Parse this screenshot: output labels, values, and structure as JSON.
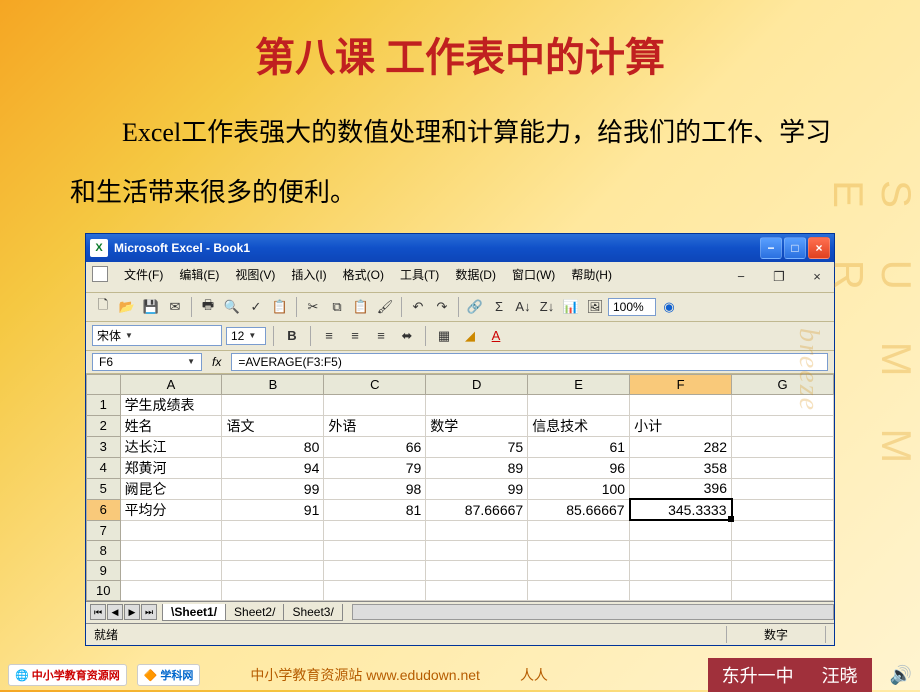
{
  "slide": {
    "title": "第八课  工作表中的计算",
    "intro": "Excel工作表强大的数值处理和计算能力，给我们的工作、学习和生活带来很多的便利。"
  },
  "excel": {
    "window_title": "Microsoft Excel - Book1",
    "menu": [
      "文件(F)",
      "编辑(E)",
      "视图(V)",
      "插入(I)",
      "格式(O)",
      "工具(T)",
      "数据(D)",
      "窗口(W)",
      "帮助(H)"
    ],
    "zoom": "100%",
    "font_name": "宋体",
    "font_size": "12",
    "name_box": "F6",
    "formula": "=AVERAGE(F3:F5)",
    "columns": [
      "A",
      "B",
      "C",
      "D",
      "E",
      "F",
      "G"
    ],
    "rows": [
      "1",
      "2",
      "3",
      "4",
      "5",
      "6",
      "7",
      "8",
      "9",
      "10"
    ],
    "table_title": "学生成绩表",
    "headers": [
      "姓名",
      "语文",
      "外语",
      "数学",
      "信息技术",
      "小计"
    ],
    "data": [
      {
        "name": "达长江",
        "vals": [
          80,
          66,
          75,
          61,
          282
        ]
      },
      {
        "name": "郑黄河",
        "vals": [
          94,
          79,
          89,
          96,
          358
        ]
      },
      {
        "name": "阙昆仑",
        "vals": [
          99,
          98,
          99,
          100,
          396
        ]
      }
    ],
    "avg_row": {
      "label": "平均分",
      "vals": [
        "91",
        "81",
        "87.66667",
        "85.66667",
        "345.3333"
      ]
    },
    "active_row": 6,
    "active_col": "F",
    "sheets": [
      "Sheet1",
      "Sheet2",
      "Sheet3"
    ],
    "status_ready": "就绪",
    "status_mode": "数字"
  },
  "footer": {
    "logo1": "中小学教育资源网",
    "logo2": "学科网",
    "site_label": "中小学教育资源站 www.edudown.net",
    "share": "人人",
    "school": "东升一中",
    "author": "汪晓"
  }
}
